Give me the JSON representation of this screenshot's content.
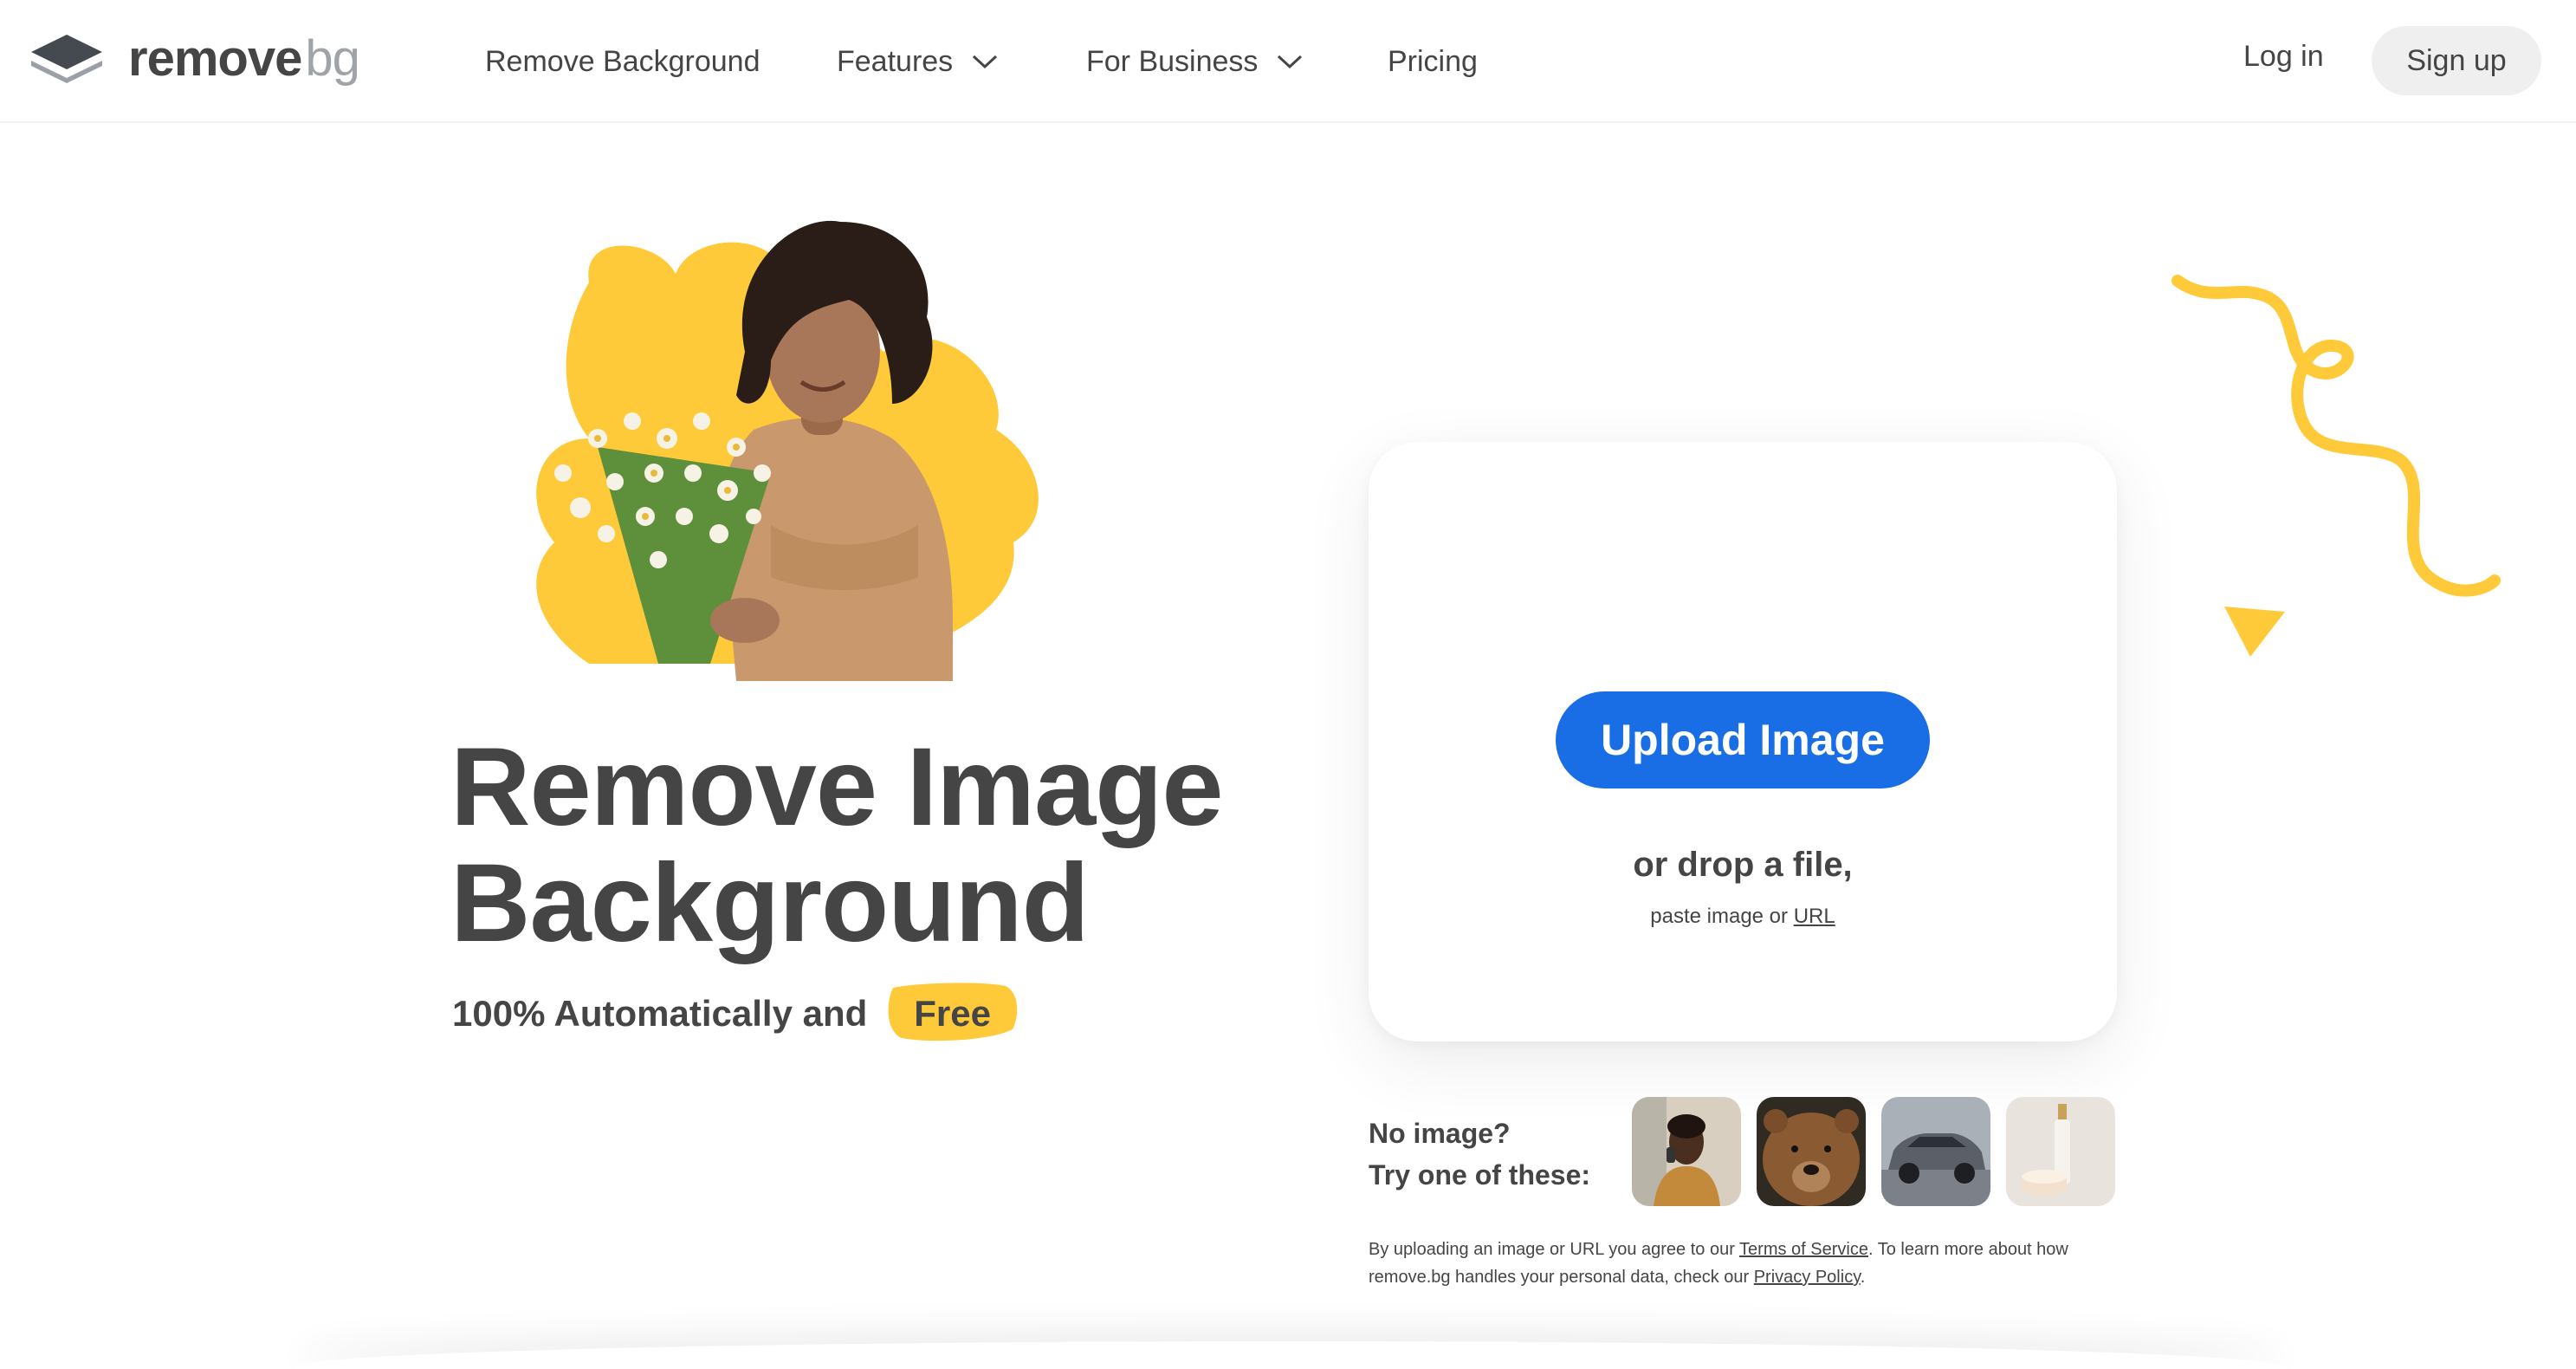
{
  "header": {
    "logo": {
      "primary": "remove",
      "secondary": "bg",
      "icon": "layers-logo-icon"
    },
    "nav": [
      {
        "label": "Remove Background",
        "has_dropdown": false
      },
      {
        "label": "Features",
        "has_dropdown": true
      },
      {
        "label": "For Business",
        "has_dropdown": true
      },
      {
        "label": "Pricing",
        "has_dropdown": false
      }
    ],
    "login_label": "Log in",
    "signup_label": "Sign up"
  },
  "hero": {
    "title_line1": "Remove Image",
    "title_line2": "Background",
    "subtitle": "100% Automatically and",
    "highlight": "Free"
  },
  "upload": {
    "button_label": "Upload Image",
    "drop_text": "or drop a file,",
    "paste_prefix": "paste image or",
    "paste_link": "URL"
  },
  "samples": {
    "line1": "No image?",
    "line2": "Try one of these:",
    "items": [
      "sample-person",
      "sample-bear",
      "sample-car",
      "sample-cosmetics"
    ]
  },
  "legal": {
    "part1": "By uploading an image or URL you agree to our ",
    "tos": "Terms of Service",
    "part2": ". To learn more about how remove.bg handles your personal data, check our ",
    "privacy": "Privacy Policy",
    "part3": "."
  },
  "colors": {
    "accent_blue": "#1a6ee5",
    "accent_yellow": "#ffca3a",
    "text": "#454545"
  }
}
